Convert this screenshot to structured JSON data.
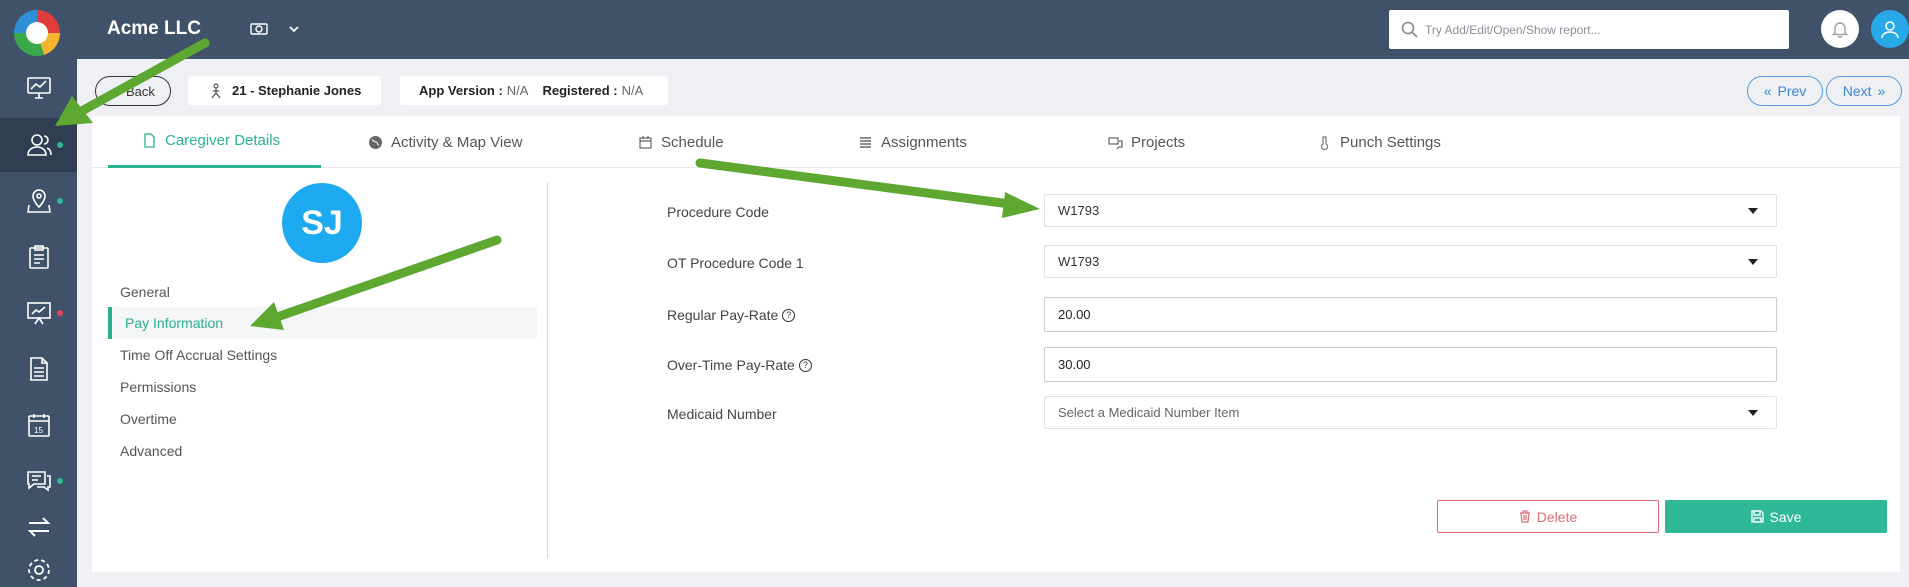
{
  "topbar": {
    "company": "Acme LLC",
    "search_placeholder": "Try Add/Edit/Open/Show report..."
  },
  "sidebar": {
    "items": [
      {
        "icon": "chart-monitor-icon",
        "dot": null
      },
      {
        "icon": "users-icon",
        "dot": "#2fb896",
        "active": true
      },
      {
        "icon": "map-pin-icon",
        "dot": "#2fb896"
      },
      {
        "icon": "clipboard-icon",
        "dot": null
      },
      {
        "icon": "presentation-chart-icon",
        "dot": "#e2455a"
      },
      {
        "icon": "document-icon",
        "dot": null
      },
      {
        "icon": "calendar-icon",
        "dot": null,
        "label": "15"
      },
      {
        "icon": "chat-icon",
        "dot": "#2fb896"
      },
      {
        "icon": "swap-arrows-icon",
        "dot": null
      },
      {
        "icon": "settings-gear-icon",
        "dot": null
      }
    ]
  },
  "subheader": {
    "back_label": "Back",
    "caregiver": "21 - Stephanie Jones",
    "app_version_label": "App Version :",
    "app_version_value": "N/A",
    "registered_label": "Registered :",
    "registered_value": "N/A",
    "prev_label": "Prev",
    "next_label": "Next"
  },
  "tabs": [
    {
      "label": "Caregiver Details",
      "icon": "document-icon",
      "active": true
    },
    {
      "label": "Activity & Map View",
      "icon": "globe-icon"
    },
    {
      "label": "Schedule",
      "icon": "calendar-icon"
    },
    {
      "label": "Assignments",
      "icon": "list-icon"
    },
    {
      "label": "Projects",
      "icon": "chat-bubbles-icon"
    },
    {
      "label": "Punch Settings",
      "icon": "thermometer-icon"
    }
  ],
  "profile": {
    "initials": "SJ"
  },
  "side_menu": [
    {
      "label": "General"
    },
    {
      "label": "Pay Information",
      "active": true
    },
    {
      "label": "Time Off Accrual Settings"
    },
    {
      "label": "Permissions"
    },
    {
      "label": "Overtime"
    },
    {
      "label": "Advanced"
    }
  ],
  "form": {
    "procedure_code_label": "Procedure Code",
    "procedure_code_value": "W1793",
    "ot_procedure_code_label": "OT Procedure Code 1",
    "ot_procedure_code_value": "W1793",
    "regular_pay_rate_label": "Regular Pay-Rate",
    "regular_pay_rate_value": "20.00",
    "overtime_pay_rate_label": "Over-Time Pay-Rate",
    "overtime_pay_rate_value": "30.00",
    "medicaid_number_label": "Medicaid Number",
    "medicaid_number_placeholder": "Select a Medicaid Number Item"
  },
  "actions": {
    "delete_label": "Delete",
    "save_label": "Save"
  },
  "colors": {
    "accent": "#2fb896",
    "brand_dark": "#3f5269",
    "danger": "#e06b78",
    "link": "#3a86d6",
    "annotation_arrow": "#5ea832"
  }
}
